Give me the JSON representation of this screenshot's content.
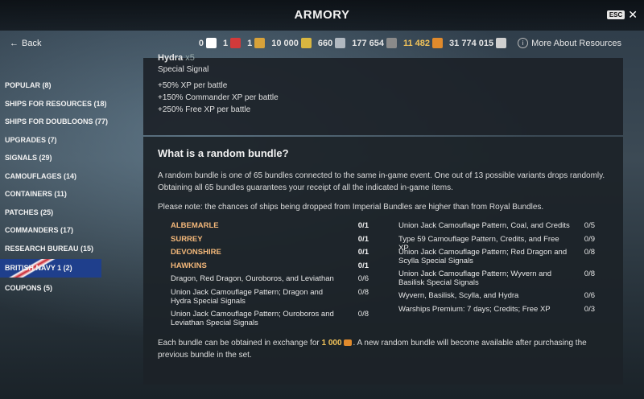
{
  "header": {
    "title": "ARMORY",
    "esc_label": "ESC",
    "close_glyph": "✕"
  },
  "nav": {
    "back_label": "Back"
  },
  "resources": [
    {
      "icon": "plus-icon",
      "value": "0",
      "color": "#ffffff"
    },
    {
      "icon": "card-icon",
      "value": "1",
      "color": "#d23a3a"
    },
    {
      "icon": "token-icon",
      "value": "1",
      "color": "#d8a23a"
    },
    {
      "icon": "coin-icon",
      "value": "10 000",
      "color": "#d9b640"
    },
    {
      "icon": "steel-icon",
      "value": "660",
      "color": "#b0b8c0"
    },
    {
      "icon": "coal-icon",
      "value": "177 654",
      "color": "#8a8a8a"
    },
    {
      "icon": "doubloon-icon",
      "value": "11 482",
      "color": "#e08a2c",
      "gold": true
    },
    {
      "icon": "credits-icon",
      "value": "31 774 015",
      "color": "#d0d0d0"
    }
  ],
  "more_resources_label": "More About Resources",
  "sidebar": {
    "items": [
      {
        "label": "POPULAR (8)"
      },
      {
        "label": "SHIPS FOR RESOURCES (18)"
      },
      {
        "label": "SHIPS FOR DOUBLOONS (77)"
      },
      {
        "label": "UPGRADES (7)"
      },
      {
        "label": "SIGNALS (29)"
      },
      {
        "label": "CAMOUFLAGES (14)"
      },
      {
        "label": "CONTAINERS (11)"
      },
      {
        "label": "PATCHES (25)"
      },
      {
        "label": "COMMANDERS (17)"
      },
      {
        "label": "RESEARCH BUREAU (15)"
      },
      {
        "label": "BRITISH NAVY 1 (2)",
        "active": true
      },
      {
        "label": "COUPONS (5)"
      }
    ]
  },
  "signal": {
    "name": "Hydra",
    "count": "x5",
    "type": "Special Signal",
    "bonuses": [
      "+50% XP per battle",
      "+150% Commander XP per battle",
      "+250% Free XP per battle"
    ]
  },
  "bundle_info": {
    "heading": "What is a random bundle?",
    "desc": "A random bundle is one of 65 bundles connected to the same in-game event. One out of 13 possible variants drops randomly. Obtaining all 65 bundles guarantees your receipt of all the indicated in-game items.",
    "note": "Please note: the chances of ships being dropped from Imperial Bundles are higher than from Royal Bundles.",
    "left_items": [
      {
        "name": "ALBEMARLE",
        "count": "0/1",
        "ship": true
      },
      {
        "name": "SURREY",
        "count": "0/1",
        "ship": true
      },
      {
        "name": "DEVONSHIRE",
        "count": "0/1",
        "ship": true
      },
      {
        "name": "HAWKINS",
        "count": "0/1",
        "ship": true
      },
      {
        "name": "Dragon, Red Dragon, Ouroboros, and Leviathan",
        "count": "0/6"
      },
      {
        "name": "Union Jack Camouflage Pattern; Dragon and Hydra Special Signals",
        "count": "0/8"
      },
      {
        "name": "Union Jack Camouflage Pattern; Ouroboros and Leviathan Special Signals",
        "count": "0/8"
      }
    ],
    "right_items": [
      {
        "name": "Union Jack Camouflage Pattern, Coal, and Credits",
        "count": "0/5"
      },
      {
        "name": "Type 59 Camouflage Pattern, Credits, and Free XP",
        "count": "0/9"
      },
      {
        "name": "Union Jack Camouflage Pattern; Red Dragon and Scylla Special Signals",
        "count": "0/8"
      },
      {
        "name": "Union Jack Camouflage Pattern; Wyvern and Basilisk Special Signals",
        "count": "0/8"
      },
      {
        "name": "Wyvern, Basilisk, Scylla, and Hydra",
        "count": "0/6"
      },
      {
        "name": "Warships Premium: 7 days; Credits; Free XP",
        "count": "0/3"
      }
    ],
    "footer_pre": "Each bundle can be obtained in exchange for",
    "footer_price": "1 000",
    "footer_post": ". A new random bundle will become available after purchasing the previous bundle in the set."
  }
}
